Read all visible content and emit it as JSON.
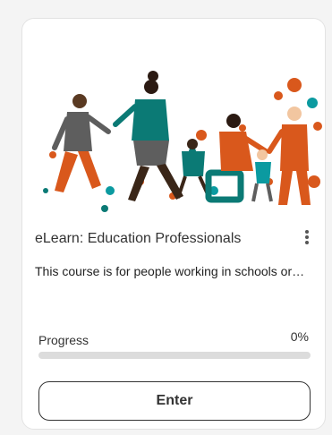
{
  "course": {
    "title": "eLearn: Education Professionals",
    "description": "This course is for people working in schools or…",
    "progress_label": "Progress",
    "progress_text": "0%",
    "progress_value": 0,
    "enter_label": "Enter"
  },
  "icons": {
    "menu": "more-vertical-icon",
    "hero": "people-illustration"
  },
  "colors": {
    "orange": "#d9581c",
    "teal": "#0b7a75",
    "dark": "#333333",
    "track": "#dcdcdc"
  }
}
